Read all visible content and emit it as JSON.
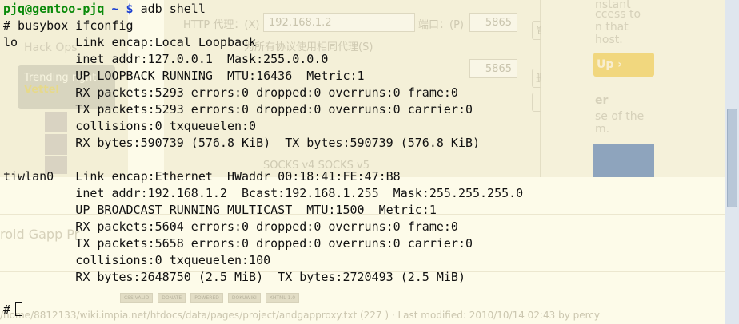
{
  "terminal": {
    "prompt_user": "pjq@gentoo-pjq",
    "prompt_dir": "~",
    "prompt_symbol": "$",
    "prompt_command": "adb shell",
    "lines": [
      "# busybox ifconfig",
      "lo        Link encap:Local Loopback",
      "          inet addr:127.0.0.1  Mask:255.0.0.0",
      "          UP LOOPBACK RUNNING  MTU:16436  Metric:1",
      "          RX packets:5293 errors:0 dropped:0 overruns:0 frame:0",
      "          TX packets:5293 errors:0 dropped:0 overruns:0 carrier:0",
      "          collisions:0 txqueuelen:0",
      "          RX bytes:590739 (576.8 KiB)  TX bytes:590739 (576.8 KiB)",
      "",
      "tiwlan0   Link encap:Ethernet  HWaddr 00:18:41:FE:47:B8",
      "          inet addr:192.168.1.2  Bcast:192.168.1.255  Mask:255.255.255.0",
      "          UP BROADCAST RUNNING MULTICAST  MTU:1500  Metric:1",
      "          RX packets:5604 errors:0 dropped:0 overruns:0 frame:0",
      "          TX packets:5658 errors:0 dropped:0 overruns:0 carrier:0",
      "          collisions:0 txqueuelen:100",
      "          RX bytes:2648750 (2.5 MiB)  TX bytes:2720493 (2.5 MiB)"
    ],
    "final_prompt": "#"
  },
  "background": {
    "left_panel": {
      "header": "Hack Ops",
      "trending_label": "Trending right",
      "trending_value": "Vettel"
    },
    "proxy_dialog": {
      "http_label": "HTTP 代理：(X)",
      "http_value": "192.168.1.2",
      "port_label": "端口：(P)",
      "port_value": "5865",
      "port_value_2": "5865",
      "same_proxy_label": "为所有协议使用相同代理(S)",
      "socks_option": "SOCKS v4   SOCKS v5",
      "buttons": [
        "置(E)...",
        "删除(C)",
        "(X)..."
      ]
    },
    "right_panel": {
      "lines": [
        "nstant",
        "ccess to",
        "n that",
        "host."
      ],
      "orange_button": "Up ›",
      "subheading": "er",
      "sub_lines": [
        "se of the",
        "m."
      ]
    },
    "footer_title": "roid Gapp Pr",
    "badges": [
      "CSS VALID",
      "DONATE",
      "POWERED",
      "DOKUWIKI",
      "XHTML 1.0"
    ],
    "footer_text": "/home/8812133/wiki.impia.net/htdocs/data/pages/project/andgapproxy.txt (227 ) · Last modified: 2010/10/14 02:43 by percy"
  }
}
